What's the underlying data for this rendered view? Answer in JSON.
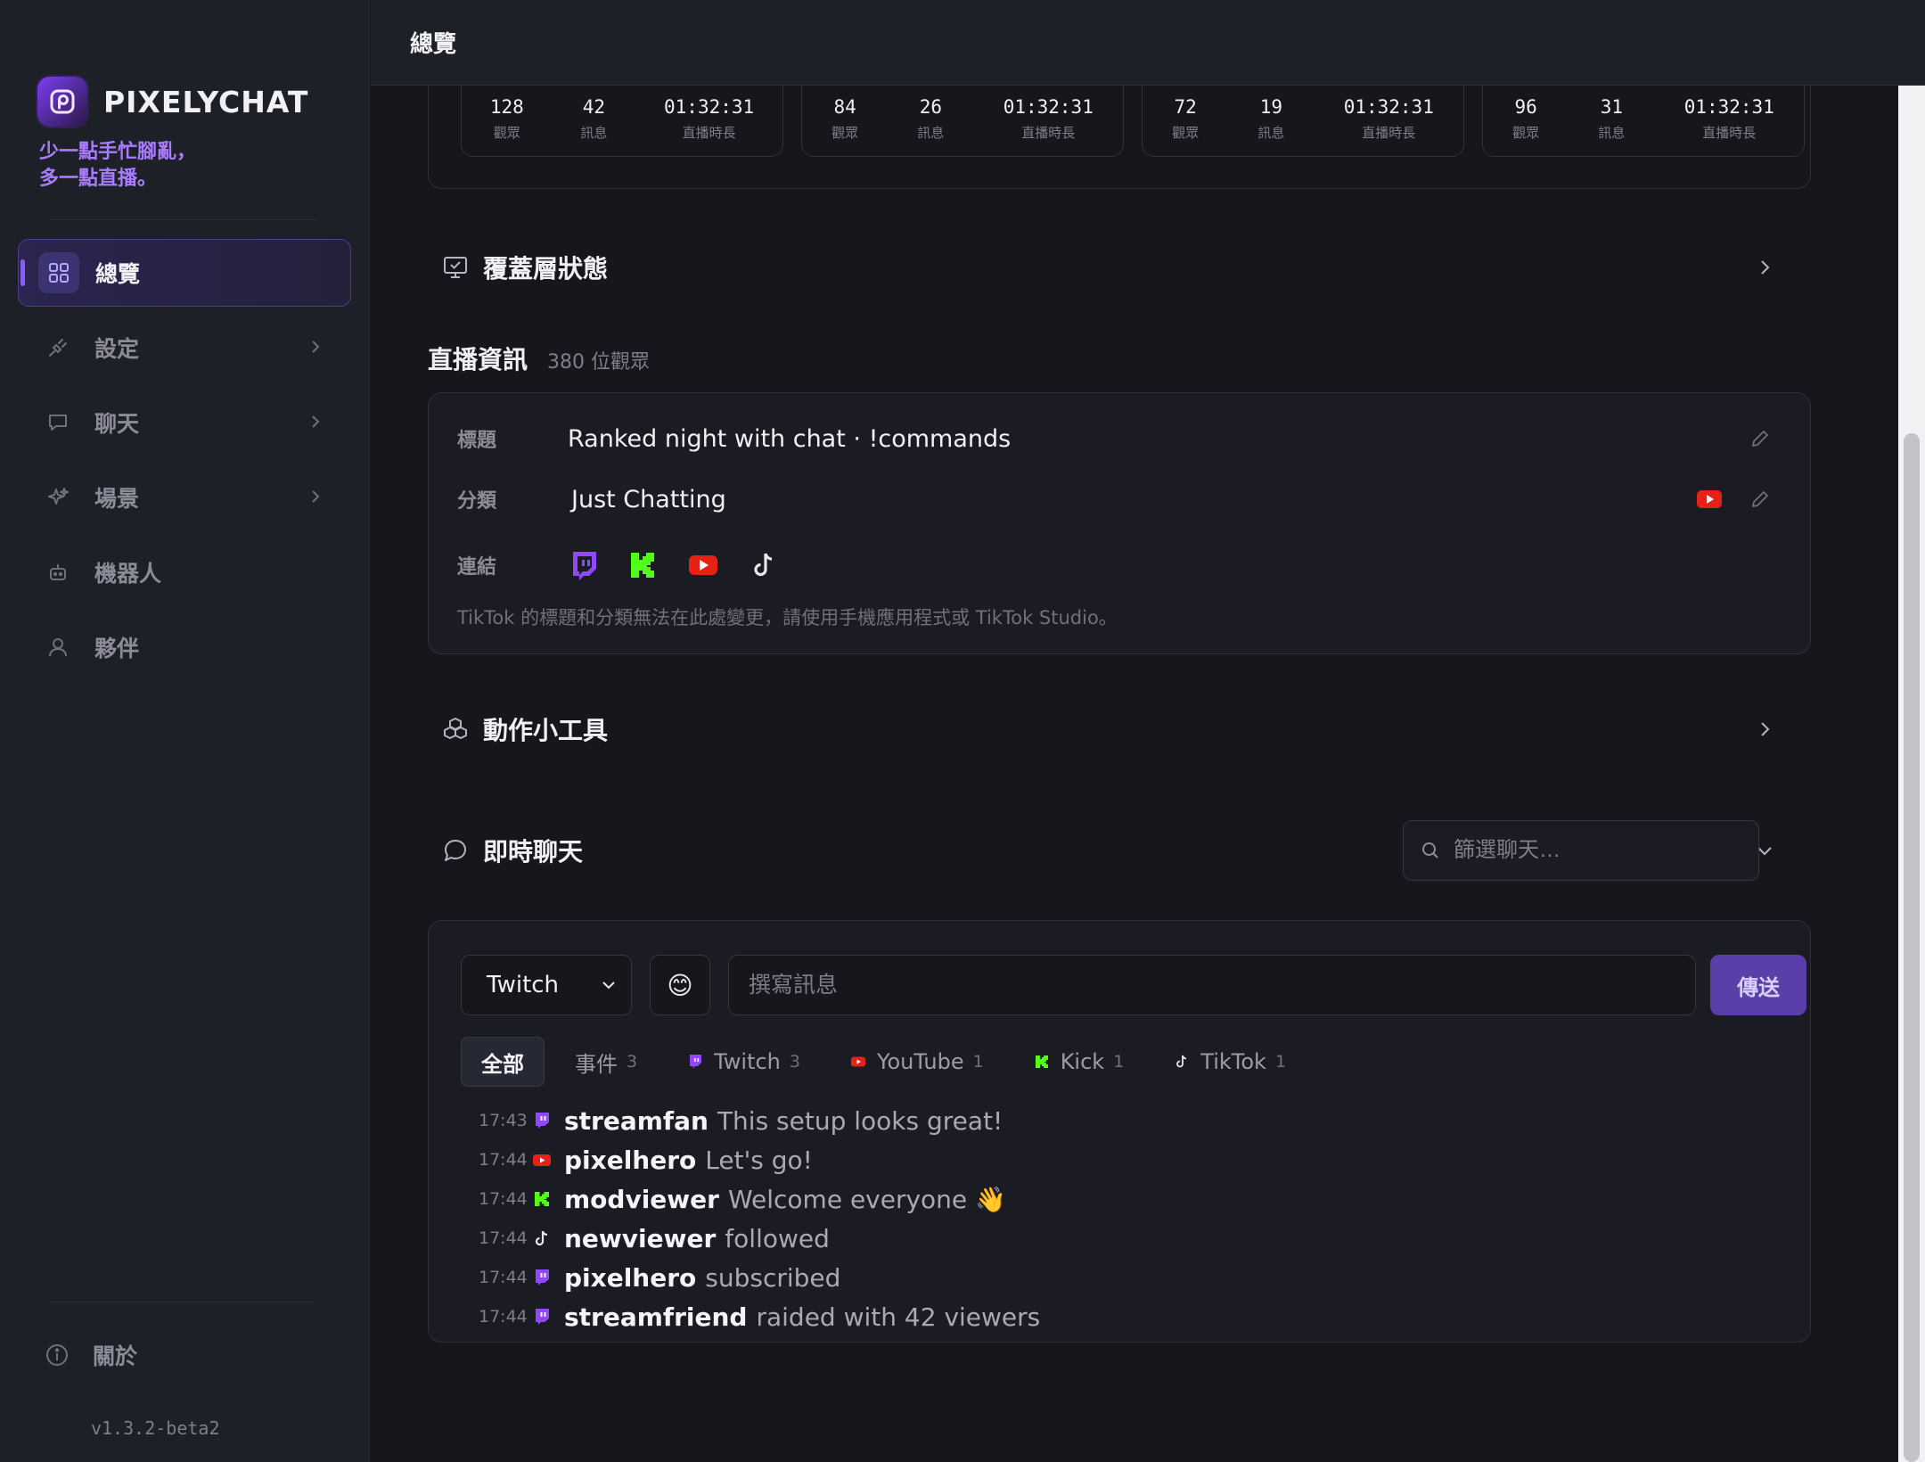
{
  "brand": {
    "name": "PIXELYCHAT",
    "tagline": "少一點手忙腳亂，\n多一點直播。"
  },
  "sidebar": {
    "items": [
      {
        "label": "總覽",
        "icon": "grid-icon",
        "active": true
      },
      {
        "label": "設定",
        "icon": "plug-icon",
        "has_chevron": true
      },
      {
        "label": "聊天",
        "icon": "chat-bubble-icon",
        "has_chevron": true
      },
      {
        "label": "場景",
        "icon": "sparkles-icon",
        "has_chevron": true
      },
      {
        "label": "機器人",
        "icon": "robot-icon"
      },
      {
        "label": "夥伴",
        "icon": "user-icon"
      }
    ],
    "about": "關於",
    "version": "v1.3.2-beta2"
  },
  "header": {
    "title": "總覽"
  },
  "stats": [
    {
      "viewers": "128",
      "messages": "42",
      "duration": "01:32:31"
    },
    {
      "viewers": "84",
      "messages": "26",
      "duration": "01:32:31"
    },
    {
      "viewers": "72",
      "messages": "19",
      "duration": "01:32:31"
    },
    {
      "viewers": "96",
      "messages": "31",
      "duration": "01:32:31"
    }
  ],
  "stat_labels": {
    "viewers": "觀眾",
    "messages": "訊息",
    "duration": "直播時長"
  },
  "overlay_section": {
    "title": "覆蓋層狀態"
  },
  "stream_info": {
    "title": "直播資訊",
    "viewers": "380 位觀眾",
    "labels": {
      "title": "標題",
      "category": "分類",
      "links": "連結"
    },
    "stream_title": "Ranked night with chat · !commands",
    "category": "Just Chatting",
    "note": "TikTok 的標題和分類無法在此處變更，請使用手機應用程式或 TikTok Studio。"
  },
  "actions_section": {
    "title": "動作小工具"
  },
  "live_chat": {
    "title": "即時聊天",
    "filter_placeholder": "篩選聊天…",
    "platform_selected": "Twitch",
    "emoji": "😊",
    "compose_placeholder": "撰寫訊息",
    "send_label": "傳送",
    "tabs": [
      {
        "label": "全部",
        "count": "",
        "active": true
      },
      {
        "label": "事件",
        "count": "3"
      },
      {
        "label": "Twitch",
        "count": "3",
        "icon": "twitch-icon"
      },
      {
        "label": "YouTube",
        "count": "1",
        "icon": "youtube-icon"
      },
      {
        "label": "Kick",
        "count": "1",
        "icon": "kick-icon"
      },
      {
        "label": "TikTok",
        "count": "1",
        "icon": "tiktok-icon"
      }
    ],
    "messages": [
      {
        "time": "17:43",
        "platform": "twitch",
        "user": "streamfan",
        "text": "This setup looks great!"
      },
      {
        "time": "17:44",
        "platform": "youtube",
        "user": "pixelhero",
        "text": "Let's go!"
      },
      {
        "time": "17:44",
        "platform": "kick",
        "user": "modviewer",
        "text": "Welcome everyone 👋"
      },
      {
        "time": "17:44",
        "platform": "tiktok",
        "user": "newviewer",
        "text": "followed"
      },
      {
        "time": "17:44",
        "platform": "twitch",
        "user": "pixelhero",
        "text": "subscribed"
      },
      {
        "time": "17:44",
        "platform": "twitch",
        "user": "streamfriend",
        "text": "raided with 42 viewers"
      }
    ]
  },
  "colors": {
    "accent": "#8a5cff",
    "tagline": "#a97bff",
    "twitch": "#9146ff",
    "youtube": "#e62117",
    "kick": "#53fc18",
    "send": "#5a3fa8"
  }
}
